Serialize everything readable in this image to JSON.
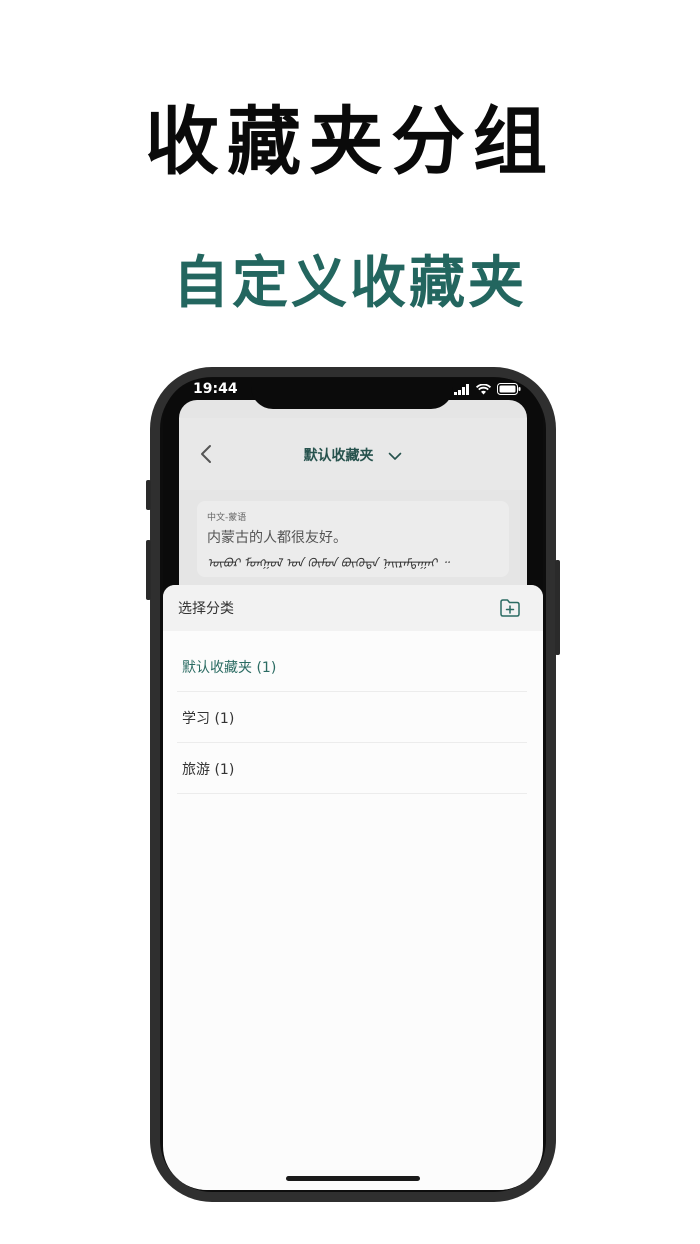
{
  "headline": "收藏夹分组",
  "subheadline": "自定义收藏夹",
  "status_bar": {
    "time": "19:44"
  },
  "nav": {
    "title": "默认收藏夹"
  },
  "card": {
    "language_pair": "中文-蒙语",
    "chinese_text": "内蒙古的人都很友好。",
    "mongolian_text": "ᠦᠪᠦᠷ ᠮᠣᠩᠭᠣᠯ ᠤᠨ ᠬᠦᠮᠦᠨ ᠪᠦᠭᠦᠳᠡ ᠨᠠᠢᠷᠠᠮᠳᠠᠭᠠᠢ ᠃"
  },
  "sheet": {
    "title": "选择分类",
    "items": [
      {
        "label": "默认收藏夹 (1)",
        "selected": true
      },
      {
        "label": "学习 (1)",
        "selected": false
      },
      {
        "label": "旅游 (1)",
        "selected": false
      }
    ]
  },
  "colors": {
    "accent": "#23665f",
    "headline": "#0a0a0a"
  }
}
